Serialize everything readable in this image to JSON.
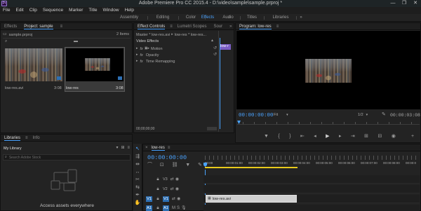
{
  "window": {
    "title": "Adobe Premiere Pro CC 2015.4 - D:\\video\\sample\\sample.prproj *",
    "app_icon": "Pr",
    "controls": [
      "—",
      "❐",
      "✕"
    ]
  },
  "menu": [
    "File",
    "Edit",
    "Clip",
    "Sequence",
    "Marker",
    "Title",
    "Window",
    "Help"
  ],
  "workspaces": {
    "items": [
      "Assembly",
      "Editing",
      "Color",
      "Effects",
      "Audio",
      "Titles",
      "Libraries"
    ],
    "active": "Effects",
    "more": "»"
  },
  "project_panel": {
    "tabs": [
      "Effects",
      "Project: sample"
    ],
    "active_tab": "Project: sample",
    "menu_icon": "≡",
    "file_name": "sample.prproj",
    "item_count": "2 Items",
    "items": [
      {
        "name": "low-res.avi",
        "duration": "3:08"
      },
      {
        "name": "low-res",
        "duration": "3:08"
      }
    ]
  },
  "effect_controls": {
    "tabs": [
      "Effect Controls",
      "Lumetri Scopes",
      "Sour"
    ],
    "more": "»",
    "active_tab": "Effect Controls",
    "master_label": "Master * low-res.avi",
    "sequence_label": "low-res * low-res...",
    "mini_clip": "low-r",
    "section_title": "Video Effects",
    "effects": [
      {
        "fx": "fx",
        "name": "Motion",
        "has_icon": true
      },
      {
        "fx": "fx",
        "name": "Opacity",
        "has_icon": false
      },
      {
        "fx": "fx",
        "name": "Time Remapping",
        "has_icon": false
      }
    ],
    "timecode": "00;00;00;00"
  },
  "program_monitor": {
    "title": "Program: low-res",
    "timecode": "00:00:00:00",
    "fit": "Fit",
    "resolution": "1/2",
    "duration": "00:00:03:08",
    "accent_color": "#4aa3ff"
  },
  "libraries_panel": {
    "tabs": [
      "Libraries",
      "Info"
    ],
    "active_tab": "Libraries",
    "library_name": "My Library",
    "search_placeholder": "Search Adobe Stock",
    "message": "Access assets everywhere"
  },
  "timeline": {
    "sequence_name": "low-res",
    "timecode": "00:00:00:00",
    "ruler": [
      "00:00",
      "00:00:01:00",
      "00:00:02:00",
      "00:00:03:00",
      "00:00:04:00",
      "00:00:05:00",
      "00:00:06:00",
      "00:00:07:00",
      "00:00:08:00",
      "00:00:0"
    ],
    "tracks": [
      {
        "id": "V3",
        "source": "",
        "kind": "video"
      },
      {
        "id": "V2",
        "source": "",
        "kind": "video"
      },
      {
        "id": "V1",
        "source": "V1",
        "kind": "video"
      },
      {
        "id": "A1",
        "source": "A1",
        "kind": "audio"
      }
    ],
    "clip_name": "low-res.avi",
    "clip_color": "#cfcfcf"
  }
}
